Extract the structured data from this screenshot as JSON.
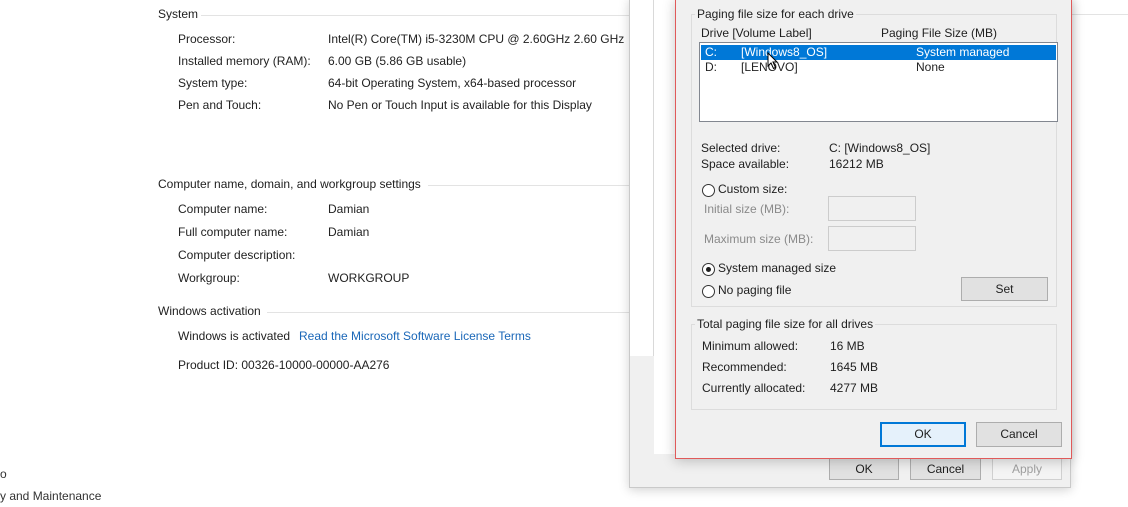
{
  "system": {
    "heading": "System",
    "rows": [
      {
        "label": "Processor:",
        "value": "Intel(R) Core(TM) i5-3230M CPU @ 2.60GHz   2.60 GHz"
      },
      {
        "label": "Installed memory (RAM):",
        "value": "6.00 GB (5.86 GB usable)"
      },
      {
        "label": "System type:",
        "value": "64-bit Operating System, x64-based processor"
      },
      {
        "label": "Pen and Touch:",
        "value": "No Pen or Touch Input is available for this Display"
      }
    ]
  },
  "computer_name": {
    "heading": "Computer name, domain, and workgroup settings",
    "rows": [
      {
        "label": "Computer name:",
        "value": "Damian"
      },
      {
        "label": "Full computer name:",
        "value": "Damian"
      },
      {
        "label": "Computer description:",
        "value": ""
      },
      {
        "label": "Workgroup:",
        "value": "WORKGROUP"
      }
    ]
  },
  "activation": {
    "heading": "Windows activation",
    "status": "Windows is activated",
    "license_link": "Read the Microsoft Software License Terms",
    "product_id": "Product ID:  00326-10000-00000-AA276"
  },
  "left_nav": {
    "item_partial_1": "o",
    "item_partial_2": "y and Maintenance"
  },
  "performance_dialog": {
    "ok_label": "OK",
    "cancel_label": "Cancel",
    "apply_label": "Apply"
  },
  "virtual_memory": {
    "group_title": "Paging file size for each drive",
    "col_drive": "Drive  [Volume Label]",
    "col_size": "Paging File Size (MB)",
    "drives": [
      {
        "drive": "C:",
        "label": "[Windows8_OS]",
        "size": "System managed",
        "selected": true
      },
      {
        "drive": "D:",
        "label": "[LENOVO]",
        "size": "None",
        "selected": false
      }
    ],
    "selected_drive_label": "Selected drive:",
    "selected_drive_value": "C:  [Windows8_OS]",
    "space_available_label": "Space available:",
    "space_available_value": "16212 MB",
    "custom_size_label": "Custom size:",
    "initial_size_label": "Initial size (MB):",
    "maximum_size_label": "Maximum size (MB):",
    "system_managed_label": "System managed size",
    "no_paging_label": "No paging file",
    "set_label": "Set",
    "total_group_title": "Total paging file size for all drives",
    "minimum_label": "Minimum allowed:",
    "minimum_value": "16 MB",
    "recommended_label": "Recommended:",
    "recommended_value": "1645 MB",
    "allocated_label": "Currently allocated:",
    "allocated_value": "4277 MB",
    "ok_label": "OK",
    "cancel_label": "Cancel",
    "selected_option": "system_managed"
  },
  "colors": {
    "accent": "#0078d7",
    "link": "#1a67b8",
    "dialog_border": "#e05a5a",
    "dialog_bg": "#f0f0f0"
  }
}
